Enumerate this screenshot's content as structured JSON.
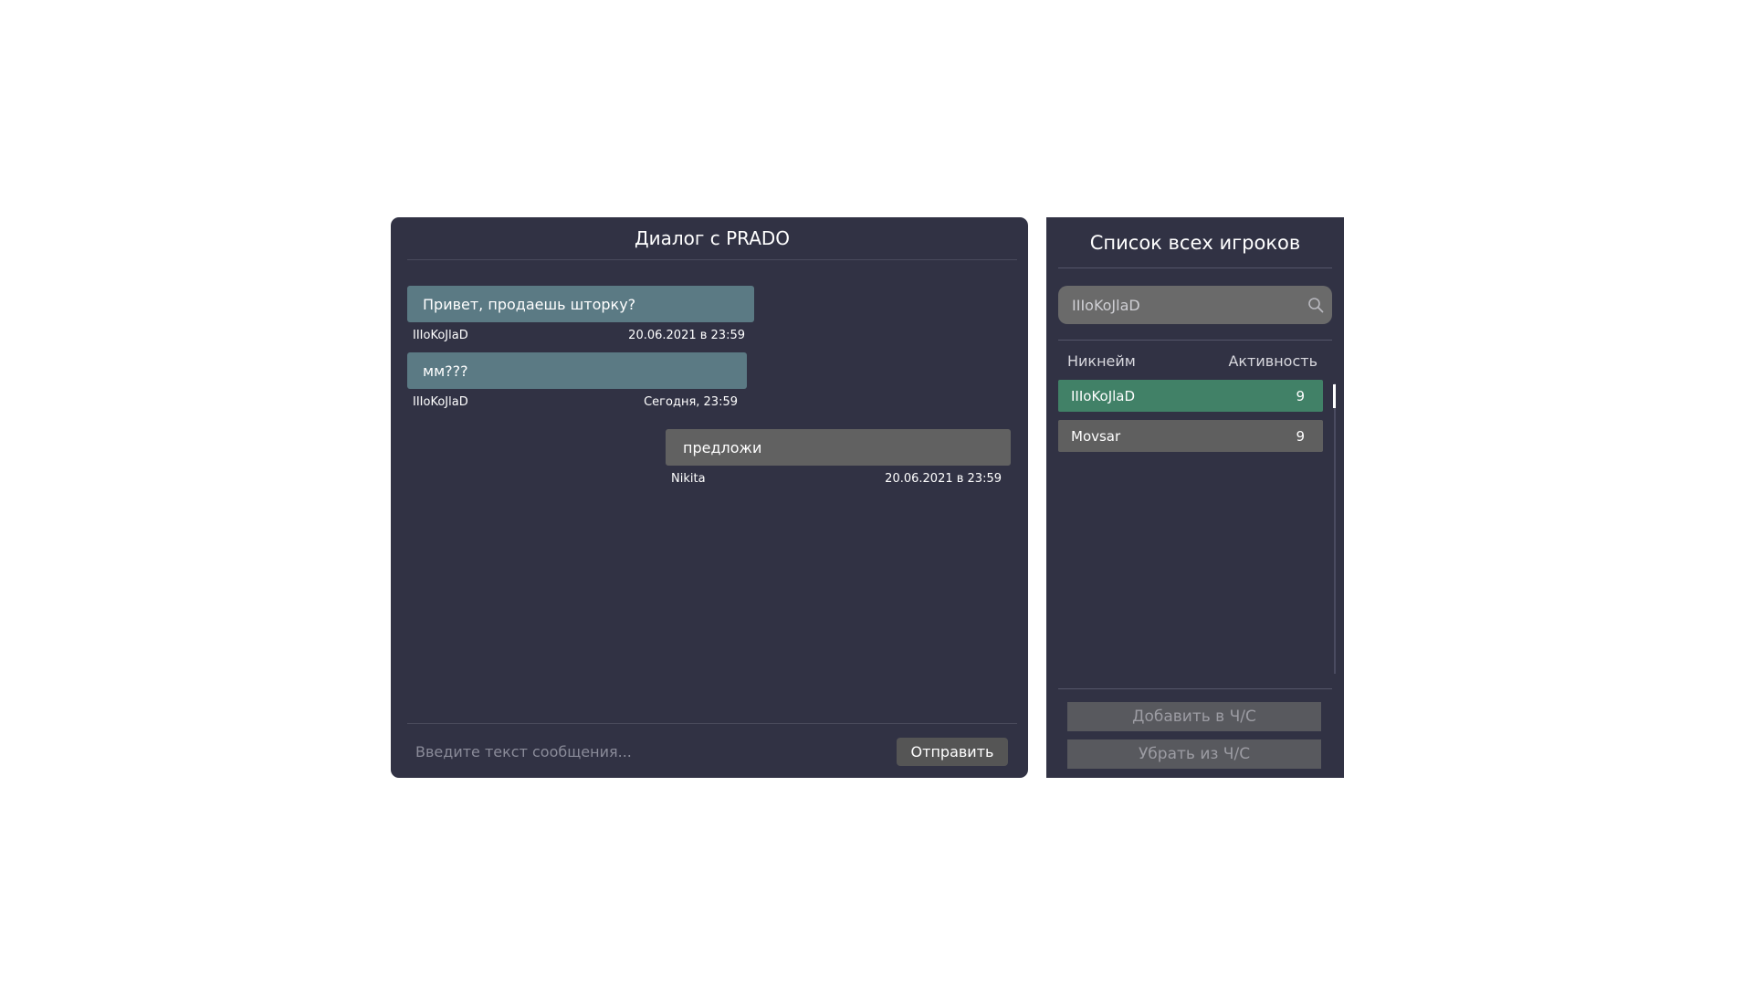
{
  "dialog": {
    "title": "Диалог с  PRADO",
    "messages": [
      {
        "text": "Привет, продаешь шторку?",
        "author": "IIIoKoJlaD",
        "time": "20.06.2021 в 23:59",
        "direction": "incoming"
      },
      {
        "text": "мм???",
        "author": "IIIoKoJlaD",
        "time": "Сегодня, 23:59",
        "direction": "incoming"
      },
      {
        "text": "предложи",
        "author": "Nikita",
        "time": "20.06.2021 в 23:59",
        "direction": "outgoing"
      }
    ],
    "input_placeholder": "Введите текст сообщения...",
    "send_label": "Отправить"
  },
  "players": {
    "title": "Список всех игроков",
    "search_value": "IIIoKoJlaD",
    "columns": {
      "nickname": "Никнейм",
      "activity": "Активность"
    },
    "rows": [
      {
        "name": "IIIoKoJlaD",
        "activity": "9",
        "selected": true
      },
      {
        "name": "Movsar",
        "activity": "9",
        "selected": false
      }
    ],
    "add_blacklist_label": "Добавить в Ч/С",
    "remove_blacklist_label": "Убрать из Ч/С"
  },
  "colors": {
    "panel_bg": "#313244",
    "incoming_bubble": "#5b7a84",
    "outgoing_bubble": "#616161",
    "selected_row": "#418167",
    "row": "#5f5f5f"
  },
  "icons": [
    "search-icon"
  ]
}
